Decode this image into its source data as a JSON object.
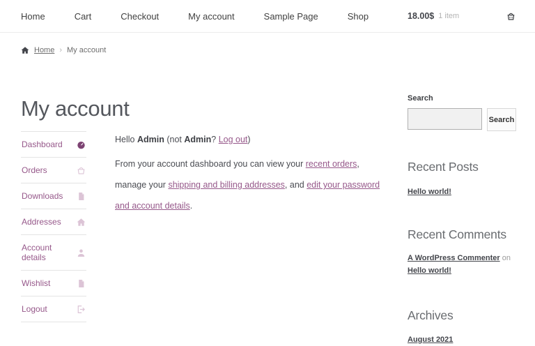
{
  "topnav": {
    "items": [
      {
        "label": "Home"
      },
      {
        "label": "Cart"
      },
      {
        "label": "Checkout"
      },
      {
        "label": "My account"
      },
      {
        "label": "Sample Page"
      },
      {
        "label": "Shop"
      }
    ],
    "cart_total": "18.00$",
    "cart_count": "1 item"
  },
  "breadcrumb": {
    "home_label": "Home",
    "separator": "›",
    "current": "My account"
  },
  "page": {
    "title": "My account"
  },
  "account_nav": {
    "items": [
      {
        "label": "Dashboard",
        "icon": "gauge-icon",
        "active": true
      },
      {
        "label": "Orders",
        "icon": "basket-icon",
        "active": false
      },
      {
        "label": "Downloads",
        "icon": "file-icon",
        "active": false
      },
      {
        "label": "Addresses",
        "icon": "home-icon",
        "active": false
      },
      {
        "label": "Account details",
        "icon": "user-icon",
        "active": false
      },
      {
        "label": "Wishlist",
        "icon": "file-icon",
        "active": false
      },
      {
        "label": "Logout",
        "icon": "sign-out-icon",
        "active": false
      }
    ]
  },
  "content": {
    "greeting": {
      "t1": "Hello ",
      "name": "Admin",
      "t2": " (not ",
      "name2": "Admin",
      "t3": "? ",
      "logout_link": "Log out",
      "t4": ")"
    },
    "para": {
      "t1": "From your account dashboard you can view your ",
      "link_recent_orders": "recent orders",
      "t2": ", manage your ",
      "link_addresses": "shipping and billing addresses",
      "t3": ", and ",
      "link_account": "edit your password and account details",
      "t4": "."
    }
  },
  "sidebar": {
    "search": {
      "label": "Search",
      "button_label": "Search",
      "input_value": ""
    },
    "recent_posts": {
      "title": "Recent Posts",
      "links": [
        {
          "label": "Hello world!"
        }
      ]
    },
    "recent_comments": {
      "title": "Recent Comments",
      "author_link": "A WordPress Commenter",
      "connector": "on",
      "post_link": "Hello world!"
    },
    "archives": {
      "title": "Archives",
      "links": [
        {
          "label": "August 2021"
        }
      ]
    }
  },
  "colors": {
    "accent_purple": "#96588a",
    "active_icon_purple": "#7d4373",
    "inactive_icon_purple": "#dcc4d6",
    "text_dark": "#43454b",
    "heading_gray": "#54575d",
    "border_light": "#e4e4e4"
  }
}
